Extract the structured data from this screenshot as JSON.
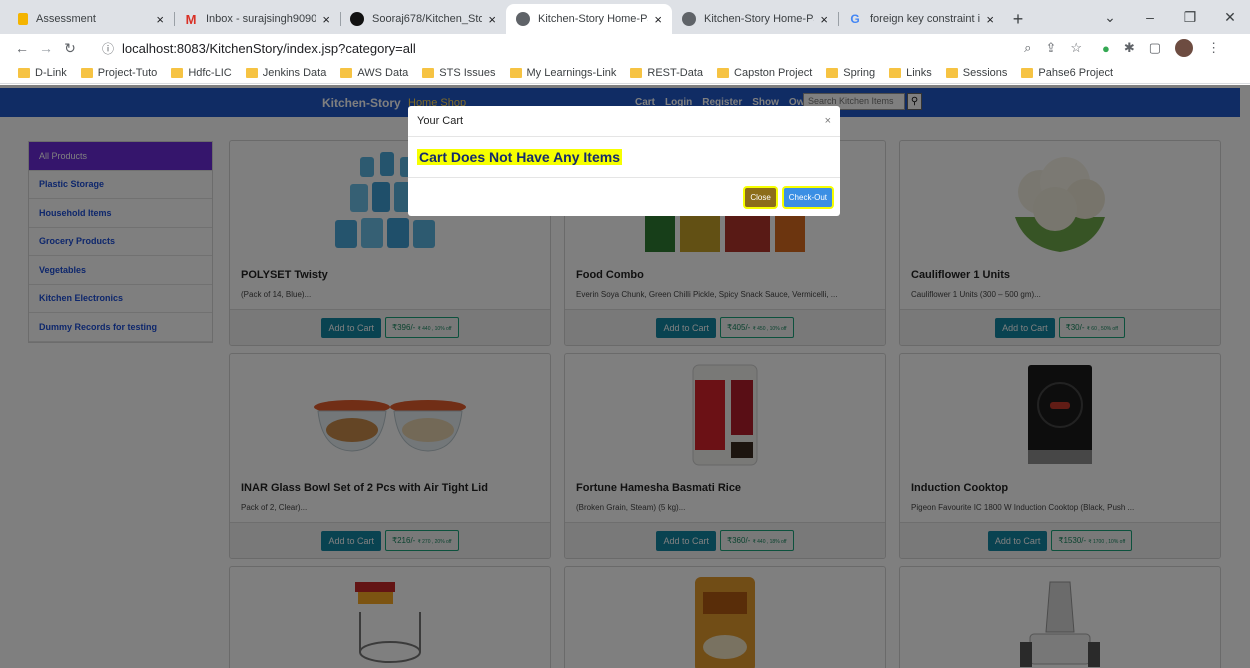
{
  "browser": {
    "tabs": [
      {
        "title": "Assessment",
        "icon": "assessment-favicon-icon",
        "active": false
      },
      {
        "title": "Inbox - surajsingh9090@gn",
        "icon": "gmail-icon",
        "active": false
      },
      {
        "title": "Sooraj678/Kitchen_Story: Pl",
        "icon": "github-icon",
        "active": false
      },
      {
        "title": "Kitchen-Story Home-Page",
        "icon": "globe-icon",
        "active": true
      },
      {
        "title": "Kitchen-Story Home-Page",
        "icon": "globe-icon",
        "active": false
      },
      {
        "title": "foreign key constraint in sq",
        "icon": "google-icon",
        "active": false
      }
    ],
    "url": "localhost:8083/KitchenStory/index.jsp?category=all",
    "bookmarks": [
      "D-Link",
      "Project-Tuto",
      "Hdfc-LIC",
      "Jenkins Data",
      "AWS Data",
      "STS Issues",
      "My Learnings-Link",
      "REST-Data",
      "Capston Project",
      "Spring",
      "Links",
      "Sessions",
      "Pahse6 Project"
    ]
  },
  "navbar": {
    "brand": "Kitchen-Story",
    "home": "Home Shop",
    "links": [
      "Cart",
      "Login",
      "Register",
      "Show",
      "Owner"
    ],
    "search_placeholder": "Search Kitchen Items",
    "search_icon": "search-icon"
  },
  "sidebar": {
    "items": [
      "All Products",
      "Plastic Storage",
      "Household Items",
      "Grocery Products",
      "Vegetables",
      "Kitchen Electronics",
      "Dummy Records for testing"
    ]
  },
  "products": [
    {
      "title": "POLYSET Twisty",
      "desc": "(Pack of 14, Blue)...",
      "add": "Add to Cart",
      "price": "₹396/-",
      "sub": "₹ 440 , 10% off"
    },
    {
      "title": "Food Combo",
      "desc": "Everin Soya Chunk, Green Chilli Pickle, Spicy Snack Sauce, Vermicelli, ...",
      "add": "Add to Cart",
      "price": "₹405/-",
      "sub": "₹ 450 , 10% off"
    },
    {
      "title": "Cauliflower 1 Units",
      "desc": "Cauliflower 1 Units (300 – 500 gm)...",
      "add": "Add to Cart",
      "price": "₹30/-",
      "sub": "₹ 60 , 50% off"
    },
    {
      "title": "INAR Glass Bowl Set of 2 Pcs with Air Tight Lid",
      "desc": "Pack of 2, Clear)...",
      "add": "Add to Cart",
      "price": "₹216/-",
      "sub": "₹ 270 , 20% off"
    },
    {
      "title": "Fortune Hamesha Basmati Rice",
      "desc": "(Broken Grain, Steam) (5 kg)...",
      "add": "Add to Cart",
      "price": "₹360/-",
      "sub": "₹ 440 , 18% off"
    },
    {
      "title": "Induction Cooktop",
      "desc": "Pigeon Favourite IC 1800 W Induction Cooktop (Black, Push ...",
      "add": "Add to Cart",
      "price": "₹1530/-",
      "sub": "₹ 1700 , 10% off"
    }
  ],
  "modal": {
    "title": "Your Cart",
    "close_icon": "×",
    "message": "Cart Does Not Have Any Items",
    "close": "Close",
    "checkout": "Check-Out"
  },
  "colors": {
    "navbar": "#2159c9",
    "sidebar_active": "#6a2bd9",
    "highlight": "#f6ff00",
    "add_button": "#1387a3"
  }
}
